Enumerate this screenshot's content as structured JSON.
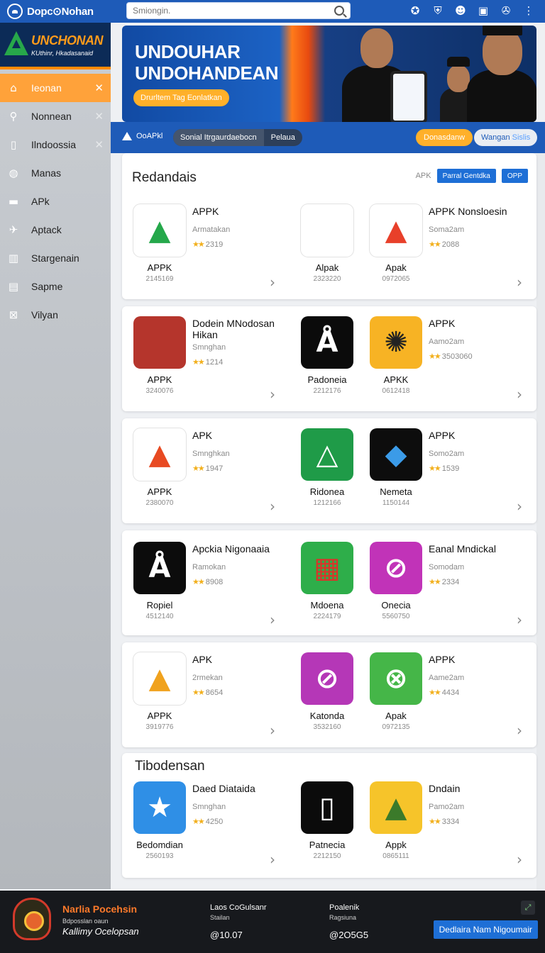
{
  "topbar": {
    "brand": "Dopc⊙Nohan",
    "search_placeholder": "Smiongin.",
    "icons": [
      "star-icon",
      "shield-icon",
      "user-icon",
      "bookmark-icon",
      "notification-icon",
      "more-icon"
    ]
  },
  "sidebar": {
    "logo_title": "UNCHONAN",
    "logo_sub": "KUthinr, Hkadasanaid",
    "items": [
      {
        "label": "Ieonan",
        "icon": "home-icon",
        "active": true,
        "closable": true
      },
      {
        "label": "Nonnean",
        "icon": "search-icon",
        "active": false,
        "closable": true
      },
      {
        "label": "Ilndoossia",
        "icon": "bag-icon",
        "active": false,
        "closable": true
      },
      {
        "label": "Manas",
        "icon": "pin-icon",
        "active": false,
        "closable": false
      },
      {
        "label": "APk",
        "icon": "folder-icon",
        "active": false,
        "closable": false
      },
      {
        "label": "Aptack",
        "icon": "bird-icon",
        "active": false,
        "closable": false
      },
      {
        "label": "Stargenain",
        "icon": "list-icon",
        "active": false,
        "closable": false
      },
      {
        "label": "Sapme",
        "icon": "window-icon",
        "active": false,
        "closable": false
      },
      {
        "label": "Vilyan",
        "icon": "box-icon",
        "active": false,
        "closable": false
      }
    ]
  },
  "hero": {
    "title_line1": "UNDOUHAR",
    "title_line2": "UNDOHANDEAN",
    "cta": "Drurltem Tag Eonlatkan"
  },
  "subbar": {
    "logo": "OoAPkl",
    "seg_left": "Sonial Itrgaurdaebocn",
    "seg_right": "Pelaua",
    "btn_orange": "Donasdanw",
    "btn_light_a": "Wangan",
    "btn_light_b": "Sislis"
  },
  "section1": {
    "title": "Redandais",
    "chip_text": "APK",
    "chip_a": "Parral Gentdka",
    "chip_b": "OPP"
  },
  "section2": {
    "title": "Tibodensan"
  },
  "rows": [
    {
      "left": {
        "name": "APPK",
        "sub": "Armatakan",
        "rating": "2319",
        "label": "APPK",
        "code": "2145169"
      },
      "mid": {
        "label": "Alpak",
        "code": "2323220"
      },
      "right": {
        "name": "APPK Nonsloesin",
        "sub": "Soma2am",
        "rating": "2088",
        "label": "Apak",
        "code": "0972065"
      }
    },
    {
      "left": {
        "name": "Dodein MNodosan",
        "name2": "Hikan",
        "sub": "Smnghan",
        "rating": "1214",
        "label": "APPK",
        "code": "3240076"
      },
      "mid": {
        "label": "Padoneia",
        "code": "2212176"
      },
      "right": {
        "name": "APPK",
        "sub": "Aamo2am",
        "rating": "3503060",
        "label": "APKK",
        "code": "0612418"
      }
    },
    {
      "left": {
        "name": "APK",
        "sub": "Smnghkan",
        "rating": "1947",
        "label": "APPK",
        "code": "2380070"
      },
      "mid": {
        "label": "Ridonea",
        "code": "1212166"
      },
      "right": {
        "name": "APPK",
        "sub": "Somo2am",
        "rating": "1539",
        "label": "Nemeta",
        "code": "1150144"
      }
    },
    {
      "left": {
        "name": "Apckia Nigonaaia",
        "sub": "Ramokan",
        "rating": "8908",
        "label": "Ropiel",
        "code": "4512140"
      },
      "mid": {
        "label": "Mdoena",
        "code": "2224179"
      },
      "right": {
        "name": "Eanal Mndickal",
        "sub": "Somodam",
        "rating": "2334",
        "label": "Onecia",
        "code": "5560750"
      }
    },
    {
      "left": {
        "name": "APK",
        "sub": "2rmekan",
        "rating": "8654",
        "label": "APPK",
        "code": "3919776"
      },
      "mid": {
        "label": "Katonda",
        "code": "3532160"
      },
      "right": {
        "name": "APPK",
        "sub": "Aame2am",
        "rating": "4434",
        "label": "Apak",
        "code": "0972135"
      }
    },
    {
      "left": {
        "name": "Daed Diataida",
        "sub": "Smnghan",
        "rating": "4250",
        "label": "Bedomdian",
        "code": "2560193"
      },
      "mid": {
        "label": "Patnecia",
        "code": "2212150"
      },
      "right": {
        "name": "Dndain",
        "sub": "Pamo2am",
        "rating": "3334",
        "label": "Appk",
        "code": "0865111"
      }
    }
  ],
  "footer": {
    "org": "Narlia Pocehsin",
    "org_sub": "Bdposslan oaun",
    "org_sub2": "Kallimy Ocelopsan",
    "col1_t1": "Laos CoGulsanr",
    "col1_t2": "Stailan",
    "col1_t3": "@10.07",
    "col2_t1": "Poalenik",
    "col2_t2": "Ragsiuna",
    "col2_t3": "@2O5G5",
    "button": "Dedlaira Nam Nigoumair"
  },
  "colors": {
    "primary": "#1e5bb8",
    "accent": "#ffa23a",
    "star": "#f2b01e"
  }
}
